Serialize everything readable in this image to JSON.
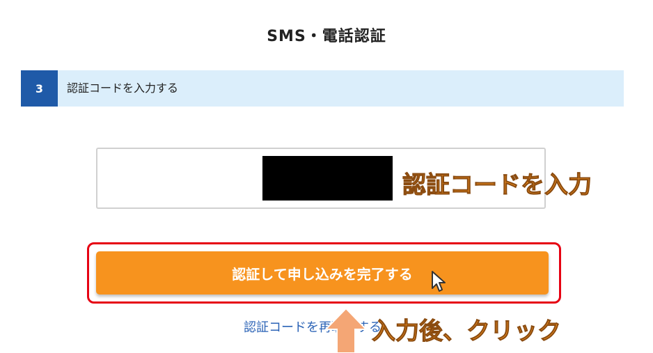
{
  "page": {
    "title": "SMS・電話認証"
  },
  "step": {
    "number": "3",
    "label": "認証コードを入力する"
  },
  "code_input": {
    "value": "",
    "placeholder": ""
  },
  "submit_button": {
    "label": "認証して申し込みを完了する"
  },
  "resend_link": {
    "label": "認証コードを再取得する"
  },
  "annotations": {
    "input_hint": "認証コードを入力",
    "click_hint": "入力後、クリック"
  },
  "colors": {
    "step_badge": "#1f5aa8",
    "step_bar": "#dbeefb",
    "button": "#f7931e",
    "highlight": "#e60012",
    "link": "#2b63b6",
    "annotation": "#f7931e"
  },
  "icons": [
    "mouse-pointer-icon",
    "up-arrow-icon"
  ]
}
